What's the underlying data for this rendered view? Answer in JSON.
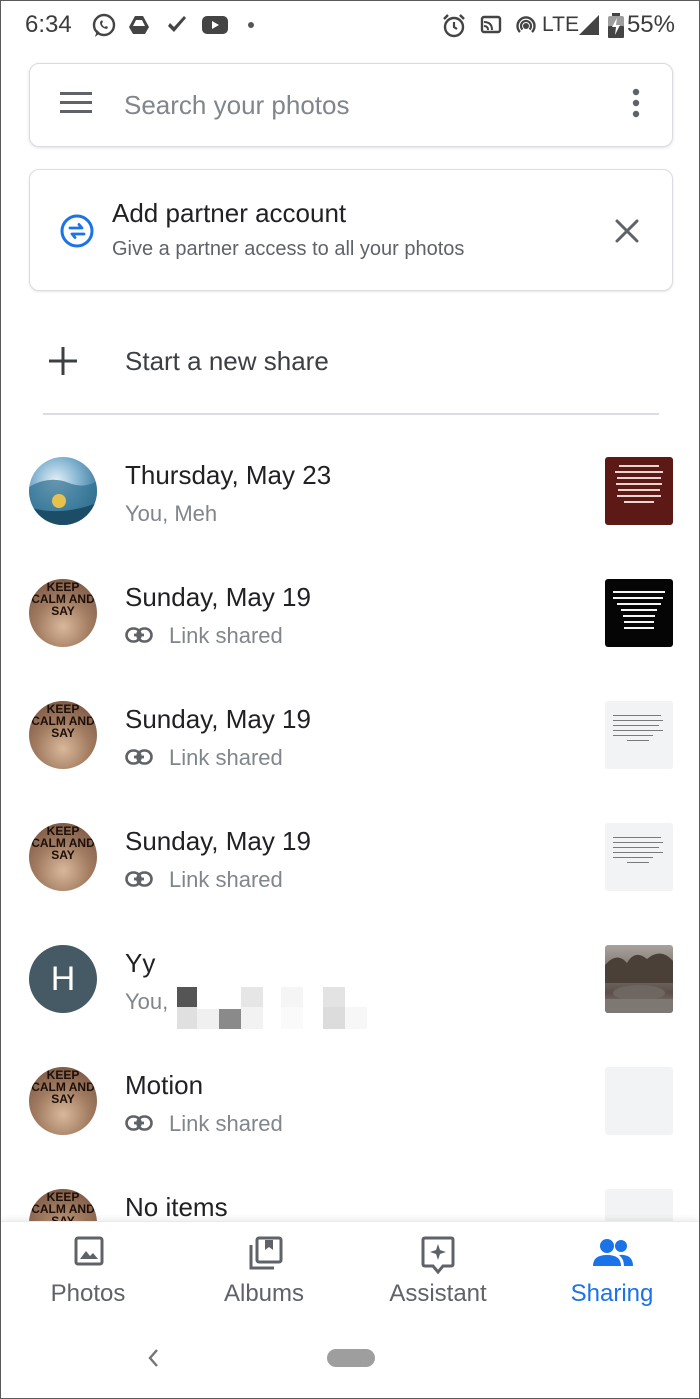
{
  "status_bar": {
    "time": "6:34",
    "network": "LTE",
    "battery": "55%"
  },
  "search": {
    "placeholder": "Search your photos"
  },
  "partner": {
    "title": "Add partner account",
    "subtitle": "Give a partner access to all your photos"
  },
  "new_share": {
    "label": "Start a new share"
  },
  "shares": [
    {
      "title": "Thursday, May 23",
      "subtitle": "You, Meh"
    },
    {
      "title": "Sunday, May 19",
      "subtitle": "Link shared"
    },
    {
      "title": "Sunday, May 19",
      "subtitle": "Link shared"
    },
    {
      "title": "Sunday, May 19",
      "subtitle": "Link shared"
    },
    {
      "title": "Yy",
      "subtitle": "You,",
      "avatar_letter": "H"
    },
    {
      "title": "Motion",
      "subtitle": "Link shared"
    },
    {
      "title": "No items"
    }
  ],
  "avatar_text": "KEEP CALM AND SAY",
  "nav": {
    "items": [
      {
        "label": "Photos",
        "icon": "photo-icon"
      },
      {
        "label": "Albums",
        "icon": "albums-icon"
      },
      {
        "label": "Assistant",
        "icon": "assistant-icon"
      },
      {
        "label": "Sharing",
        "icon": "sharing-icon",
        "active": true
      }
    ],
    "accent": "#1a73e8"
  }
}
